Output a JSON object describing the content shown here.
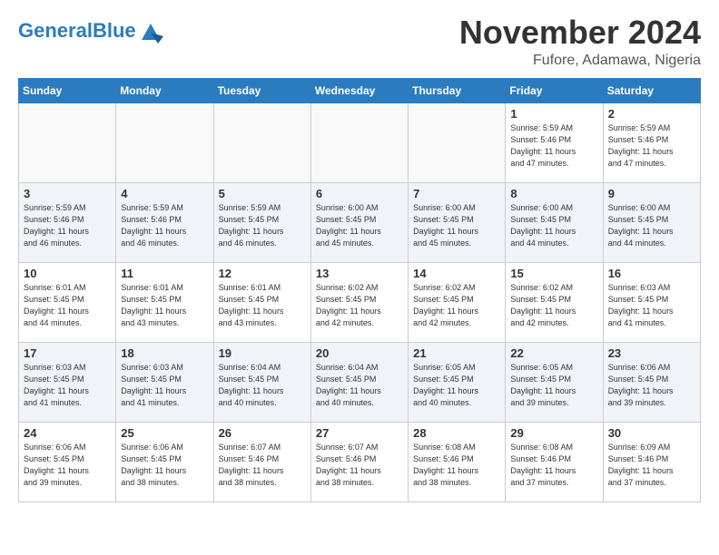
{
  "header": {
    "logo_general": "General",
    "logo_blue": "Blue",
    "month": "November 2024",
    "location": "Fufore, Adamawa, Nigeria"
  },
  "weekdays": [
    "Sunday",
    "Monday",
    "Tuesday",
    "Wednesday",
    "Thursday",
    "Friday",
    "Saturday"
  ],
  "weeks": [
    [
      {
        "day": "",
        "info": ""
      },
      {
        "day": "",
        "info": ""
      },
      {
        "day": "",
        "info": ""
      },
      {
        "day": "",
        "info": ""
      },
      {
        "day": "",
        "info": ""
      },
      {
        "day": "1",
        "info": "Sunrise: 5:59 AM\nSunset: 5:46 PM\nDaylight: 11 hours\nand 47 minutes."
      },
      {
        "day": "2",
        "info": "Sunrise: 5:59 AM\nSunset: 5:46 PM\nDaylight: 11 hours\nand 47 minutes."
      }
    ],
    [
      {
        "day": "3",
        "info": "Sunrise: 5:59 AM\nSunset: 5:46 PM\nDaylight: 11 hours\nand 46 minutes."
      },
      {
        "day": "4",
        "info": "Sunrise: 5:59 AM\nSunset: 5:46 PM\nDaylight: 11 hours\nand 46 minutes."
      },
      {
        "day": "5",
        "info": "Sunrise: 5:59 AM\nSunset: 5:45 PM\nDaylight: 11 hours\nand 46 minutes."
      },
      {
        "day": "6",
        "info": "Sunrise: 6:00 AM\nSunset: 5:45 PM\nDaylight: 11 hours\nand 45 minutes."
      },
      {
        "day": "7",
        "info": "Sunrise: 6:00 AM\nSunset: 5:45 PM\nDaylight: 11 hours\nand 45 minutes."
      },
      {
        "day": "8",
        "info": "Sunrise: 6:00 AM\nSunset: 5:45 PM\nDaylight: 11 hours\nand 44 minutes."
      },
      {
        "day": "9",
        "info": "Sunrise: 6:00 AM\nSunset: 5:45 PM\nDaylight: 11 hours\nand 44 minutes."
      }
    ],
    [
      {
        "day": "10",
        "info": "Sunrise: 6:01 AM\nSunset: 5:45 PM\nDaylight: 11 hours\nand 44 minutes."
      },
      {
        "day": "11",
        "info": "Sunrise: 6:01 AM\nSunset: 5:45 PM\nDaylight: 11 hours\nand 43 minutes."
      },
      {
        "day": "12",
        "info": "Sunrise: 6:01 AM\nSunset: 5:45 PM\nDaylight: 11 hours\nand 43 minutes."
      },
      {
        "day": "13",
        "info": "Sunrise: 6:02 AM\nSunset: 5:45 PM\nDaylight: 11 hours\nand 42 minutes."
      },
      {
        "day": "14",
        "info": "Sunrise: 6:02 AM\nSunset: 5:45 PM\nDaylight: 11 hours\nand 42 minutes."
      },
      {
        "day": "15",
        "info": "Sunrise: 6:02 AM\nSunset: 5:45 PM\nDaylight: 11 hours\nand 42 minutes."
      },
      {
        "day": "16",
        "info": "Sunrise: 6:03 AM\nSunset: 5:45 PM\nDaylight: 11 hours\nand 41 minutes."
      }
    ],
    [
      {
        "day": "17",
        "info": "Sunrise: 6:03 AM\nSunset: 5:45 PM\nDaylight: 11 hours\nand 41 minutes."
      },
      {
        "day": "18",
        "info": "Sunrise: 6:03 AM\nSunset: 5:45 PM\nDaylight: 11 hours\nand 41 minutes."
      },
      {
        "day": "19",
        "info": "Sunrise: 6:04 AM\nSunset: 5:45 PM\nDaylight: 11 hours\nand 40 minutes."
      },
      {
        "day": "20",
        "info": "Sunrise: 6:04 AM\nSunset: 5:45 PM\nDaylight: 11 hours\nand 40 minutes."
      },
      {
        "day": "21",
        "info": "Sunrise: 6:05 AM\nSunset: 5:45 PM\nDaylight: 11 hours\nand 40 minutes."
      },
      {
        "day": "22",
        "info": "Sunrise: 6:05 AM\nSunset: 5:45 PM\nDaylight: 11 hours\nand 39 minutes."
      },
      {
        "day": "23",
        "info": "Sunrise: 6:06 AM\nSunset: 5:45 PM\nDaylight: 11 hours\nand 39 minutes."
      }
    ],
    [
      {
        "day": "24",
        "info": "Sunrise: 6:06 AM\nSunset: 5:45 PM\nDaylight: 11 hours\nand 39 minutes."
      },
      {
        "day": "25",
        "info": "Sunrise: 6:06 AM\nSunset: 5:45 PM\nDaylight: 11 hours\nand 38 minutes."
      },
      {
        "day": "26",
        "info": "Sunrise: 6:07 AM\nSunset: 5:46 PM\nDaylight: 11 hours\nand 38 minutes."
      },
      {
        "day": "27",
        "info": "Sunrise: 6:07 AM\nSunset: 5:46 PM\nDaylight: 11 hours\nand 38 minutes."
      },
      {
        "day": "28",
        "info": "Sunrise: 6:08 AM\nSunset: 5:46 PM\nDaylight: 11 hours\nand 38 minutes."
      },
      {
        "day": "29",
        "info": "Sunrise: 6:08 AM\nSunset: 5:46 PM\nDaylight: 11 hours\nand 37 minutes."
      },
      {
        "day": "30",
        "info": "Sunrise: 6:09 AM\nSunset: 5:46 PM\nDaylight: 11 hours\nand 37 minutes."
      }
    ]
  ]
}
